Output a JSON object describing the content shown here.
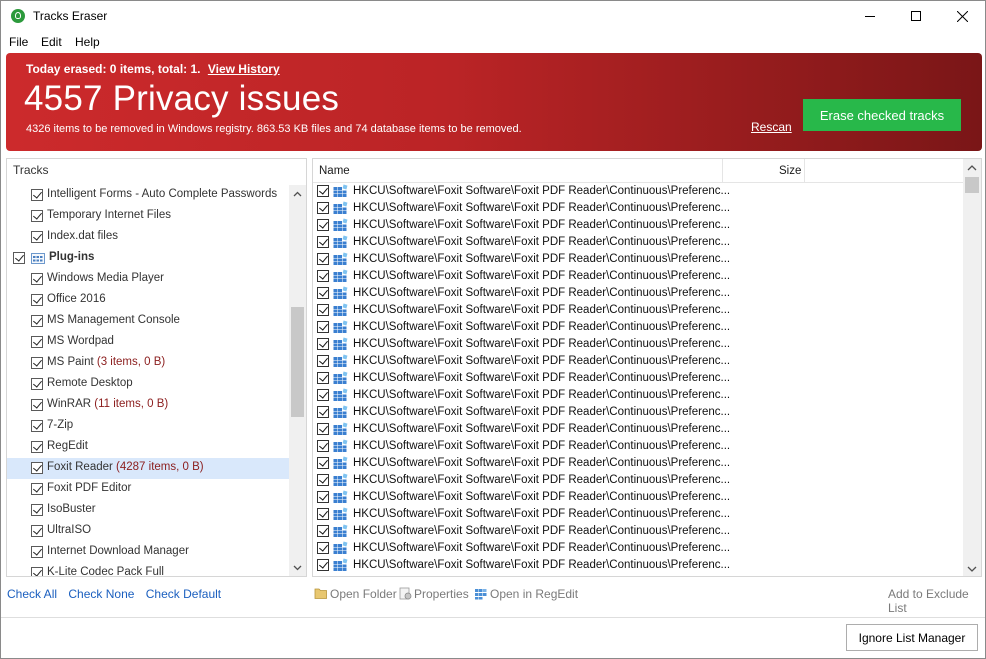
{
  "window": {
    "title": "Tracks Eraser"
  },
  "menu": [
    "File",
    "Edit",
    "Help"
  ],
  "banner": {
    "today_text": "Today erased: 0 items, total: 1.",
    "view_history": "View History",
    "headline": "4557 Privacy issues",
    "subtext": "4326 items to be removed in Windows registry. 863.53 KB files and 74 database items to be removed.",
    "rescan": "Rescan",
    "erase_button": "Erase checked tracks",
    "colors": {
      "banner": "#c0272a",
      "erase": "#28b84a"
    }
  },
  "tracks": {
    "header": "Tracks",
    "items": [
      {
        "label": "Intelligent Forms - Auto Complete Passwords",
        "count": ""
      },
      {
        "label": "Temporary Internet Files",
        "count": ""
      },
      {
        "label": "Index.dat files",
        "count": ""
      },
      {
        "label": "Plug-ins",
        "count": "",
        "group": true
      },
      {
        "label": "Windows Media Player",
        "count": ""
      },
      {
        "label": "Office 2016",
        "count": ""
      },
      {
        "label": "MS Management Console",
        "count": ""
      },
      {
        "label": "MS Wordpad",
        "count": ""
      },
      {
        "label": "MS Paint",
        "count": "(3 items, 0 B)"
      },
      {
        "label": "Remote Desktop",
        "count": ""
      },
      {
        "label": "WinRAR",
        "count": "(11 items, 0 B)"
      },
      {
        "label": "7-Zip",
        "count": ""
      },
      {
        "label": "RegEdit",
        "count": ""
      },
      {
        "label": "Foxit Reader",
        "count": "(4287 items, 0 B)",
        "selected": true
      },
      {
        "label": "Foxit PDF Editor",
        "count": ""
      },
      {
        "label": "IsoBuster",
        "count": ""
      },
      {
        "label": "UltraISO",
        "count": ""
      },
      {
        "label": "Internet Download Manager",
        "count": ""
      },
      {
        "label": "K-Lite Codec Pack Full",
        "count": ""
      }
    ]
  },
  "bottom_links": {
    "check_all": "Check All",
    "check_none": "Check None",
    "check_default": "Check Default"
  },
  "results": {
    "col_name": "Name",
    "col_size": "Size",
    "row_text": "HKCU\\Software\\Foxit Software\\Foxit PDF Reader\\Continuous\\Preferenc...",
    "row_count": 23
  },
  "actions": {
    "open_folder": "Open Folder",
    "properties": "Properties",
    "open_regedit": "Open in RegEdit",
    "add_exclude": "Add to Exclude List"
  },
  "ignore_button": "Ignore List Manager"
}
